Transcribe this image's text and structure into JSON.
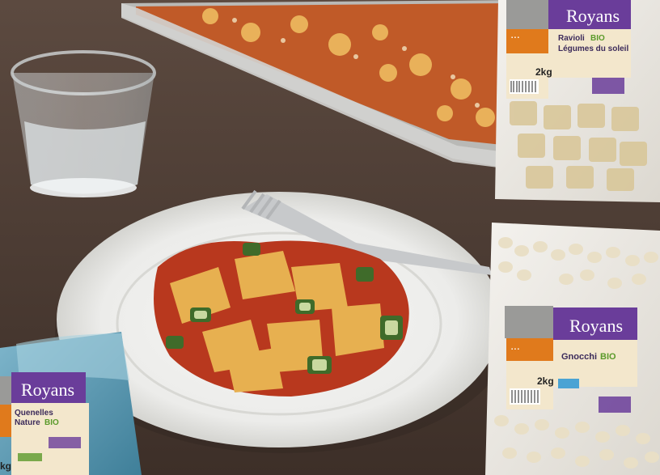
{
  "colors": {
    "table": "#4a3a32",
    "plate": "#eeeeec",
    "brand_purple": "#6a3d9a",
    "label_orange": "#e07a1c",
    "label_cream": "#f3e7cc",
    "sauce_red": "#b8381e",
    "pasta_yellow": "#e7b050"
  },
  "products": {
    "ravioli": {
      "brand": "Royans",
      "name_line1": "Ravioli",
      "bio": "BIO",
      "name_line2": "Légumes du soleil",
      "weight": "2kg"
    },
    "gnocchi": {
      "brand": "Royans",
      "name": "Gnocchi",
      "bio": "BIO",
      "weight": "2kg"
    },
    "quenelles": {
      "brand": "Royans",
      "name_line1": "Quenelles",
      "name_line2": "Nature",
      "bio": "BIO",
      "weight": "kg"
    }
  }
}
